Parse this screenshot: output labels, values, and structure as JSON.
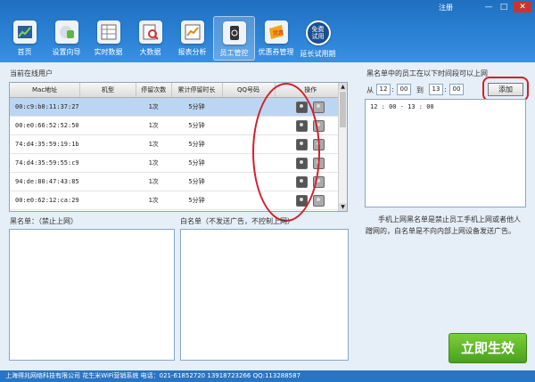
{
  "window": {
    "register_label": "注册",
    "minimize_glyph": "—",
    "restore_glyph": "□",
    "close_glyph": "✕"
  },
  "toolbar": [
    {
      "label": "首页",
      "icon": "home-chart-icon"
    },
    {
      "label": "设置向导",
      "icon": "wizard-icon"
    },
    {
      "label": "实时数据",
      "icon": "realtime-data-icon"
    },
    {
      "label": "大数据",
      "icon": "bigdata-icon"
    },
    {
      "label": "报表分析",
      "icon": "report-icon"
    },
    {
      "label": "员工管控",
      "icon": "staff-control-icon"
    },
    {
      "label": "优惠券管理",
      "icon": "coupon-icon"
    },
    {
      "label": "延长试用期",
      "icon": "free-trial-icon",
      "badge": "免费\n试用"
    }
  ],
  "online": {
    "title": "当前在线用户",
    "columns": [
      "Mac地址",
      "机型",
      "停留次数",
      "累计停留时长",
      "QQ号码",
      "操作"
    ],
    "rows": [
      {
        "mac": "00:c9:b0:11:37:27",
        "model": "",
        "visits": "1次",
        "duration": "5分钟",
        "qq": ""
      },
      {
        "mac": "00:e0:66:52:52:50",
        "model": "",
        "visits": "1次",
        "duration": "5分钟",
        "qq": ""
      },
      {
        "mac": "74:d4:35:59:19:1b",
        "model": "",
        "visits": "1次",
        "duration": "5分钟",
        "qq": ""
      },
      {
        "mac": "74:d4:35:59:55:c9",
        "model": "",
        "visits": "1次",
        "duration": "5分钟",
        "qq": ""
      },
      {
        "mac": "94:de:80:47:43:85",
        "model": "",
        "visits": "1次",
        "duration": "5分钟",
        "qq": ""
      },
      {
        "mac": "00:e0:62:12:ca:29",
        "model": "",
        "visits": "1次",
        "duration": "5分钟",
        "qq": ""
      }
    ]
  },
  "blacklist": {
    "title": "黑名单：（禁止上网）"
  },
  "whitelist": {
    "title": "白名单（不发送广告，不控制上网）"
  },
  "schedule": {
    "title": "黑名单中的员工在以下时间段可以上网",
    "from_label": "从",
    "to_label": "到",
    "from_hour": "12",
    "from_min": "00",
    "to_hour": "13",
    "to_min": "00",
    "add_label": "添加",
    "entries": [
      "12 : 00 - 13 : 00"
    ]
  },
  "note": "手机上网黑名单是禁止员工手机上网或者他人蹭网的，白名单是不向内部上网设备发送广告。",
  "apply_label": "立即生效",
  "status": "上海得兆网络科技有限公司  花生米WiFi营销系统  电话：021-61852720    13918723266    QQ:113288587",
  "colors": {
    "accent": "#2c83d6",
    "apply": "#4aa11d",
    "highlight": "#d0202a"
  }
}
